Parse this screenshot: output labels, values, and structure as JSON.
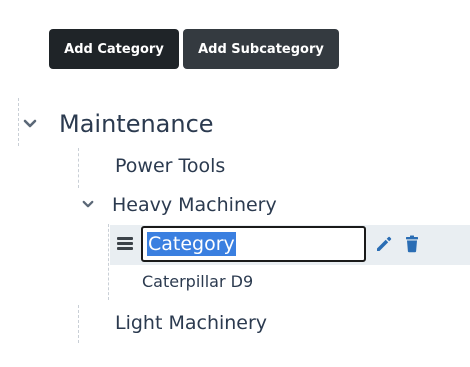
{
  "toolbar": {
    "add_category_label": "Add Category",
    "add_subcategory_label": "Add Subcategory"
  },
  "tree": {
    "root": {
      "label": "Maintenance",
      "expanded": true,
      "children": [
        {
          "label": "Power Tools"
        },
        {
          "label": "Heavy Machinery",
          "expanded": true,
          "children": [
            {
              "editing": true,
              "value": "Category",
              "selected": true
            },
            {
              "label": "Caterpillar D9"
            }
          ]
        },
        {
          "label": "Light Machinery"
        }
      ]
    }
  },
  "icons": {
    "expand": "chevron-down-icon",
    "drag": "drag-handle-icon",
    "edit": "pencil-icon",
    "delete": "trash-icon"
  },
  "colors": {
    "primary_dark": "#1f2428",
    "secondary_dark": "#343a40",
    "action_blue": "#2a6db4",
    "text": "#2b3a4f",
    "selection_highlight": "#3a7fe0",
    "row_highlight": "#e9eef2"
  }
}
